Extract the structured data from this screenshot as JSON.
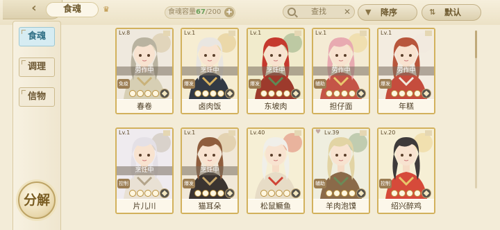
{
  "header": {
    "tab_title": "食魂",
    "capacity_label": "食魂容量",
    "capacity_current": "67",
    "capacity_max": "/200",
    "search_placeholder": "查找",
    "sort_label": "降序",
    "default_label": "默认"
  },
  "sidebar": {
    "items": [
      {
        "label": "食魂",
        "active": true
      },
      {
        "label": "调理",
        "active": false
      },
      {
        "label": "信物",
        "active": false
      }
    ],
    "decompose_label": "分解"
  },
  "cards": [
    {
      "level": "Lv.8",
      "status": "劳作中",
      "badge": "免疫",
      "name": "春卷",
      "hair": "#b9b3a0",
      "bg": "#efe9de",
      "outfit": "#d7cfb4",
      "accent": "#c9b27a"
    },
    {
      "level": "Lv.1",
      "status": "烹饪中",
      "badge": "爆发",
      "name": "卤肉饭",
      "hair": "#e9e6e1",
      "bg": "#f6edd2",
      "outfit": "#333a44",
      "accent": "#d8b25e"
    },
    {
      "level": "Lv.1",
      "status": "烹饪中",
      "badge": "爆发",
      "name": "东坡肉",
      "hair": "#c5392e",
      "bg": "#f1ebcc",
      "outfit": "#9d3a2c",
      "accent": "#5d8a55"
    },
    {
      "level": "Lv.1",
      "status": "劳作中",
      "badge": "辅助",
      "name": "担仔面",
      "hair": "#e8aab1",
      "bg": "#f4ebd4",
      "outfit": "#c45547",
      "accent": "#e9c86e"
    },
    {
      "level": "Lv.1",
      "status": "劳作中",
      "badge": "爆发",
      "name": "年糕",
      "hair": "#b8563c",
      "bg": "#f3ece0",
      "outfit": "#c54c3d",
      "accent": "#f1e9dc"
    },
    {
      "level": "Lv.1",
      "status": "烹饪中",
      "badge": "控制",
      "name": "片儿川",
      "hair": "#e4e0e6",
      "bg": "#efebef",
      "outfit": "#e9e1d4",
      "accent": "#b3a48a"
    },
    {
      "level": "Lv.1",
      "status": "烹饪中",
      "badge": "爆发",
      "name": "猫耳朵",
      "hair": "#8f5d3d",
      "bg": "#f1e8d8",
      "outfit": "#3b3430",
      "accent": "#c8a86a"
    },
    {
      "level": "Lv.40",
      "status": "",
      "badge": "",
      "name": "松鼠鳜鱼",
      "hair": "#f0efe9",
      "bg": "#f6efd5",
      "outfit": "#e7dcc6",
      "accent": "#d04436"
    },
    {
      "level": "Lv.39",
      "status": "",
      "badge": "辅助",
      "name": "羊肉泡馍",
      "hair": "#e2d4a4",
      "bg": "#efeedf",
      "outfit": "#8a6a49",
      "accent": "#6b8b58"
    },
    {
      "level": "Lv.20",
      "status": "",
      "badge": "控制",
      "name": "绍兴醉鸡",
      "hair": "#3e3a3a",
      "bg": "#f6efd5",
      "outfit": "#d64a3a",
      "accent": "#e8c66a"
    }
  ]
}
